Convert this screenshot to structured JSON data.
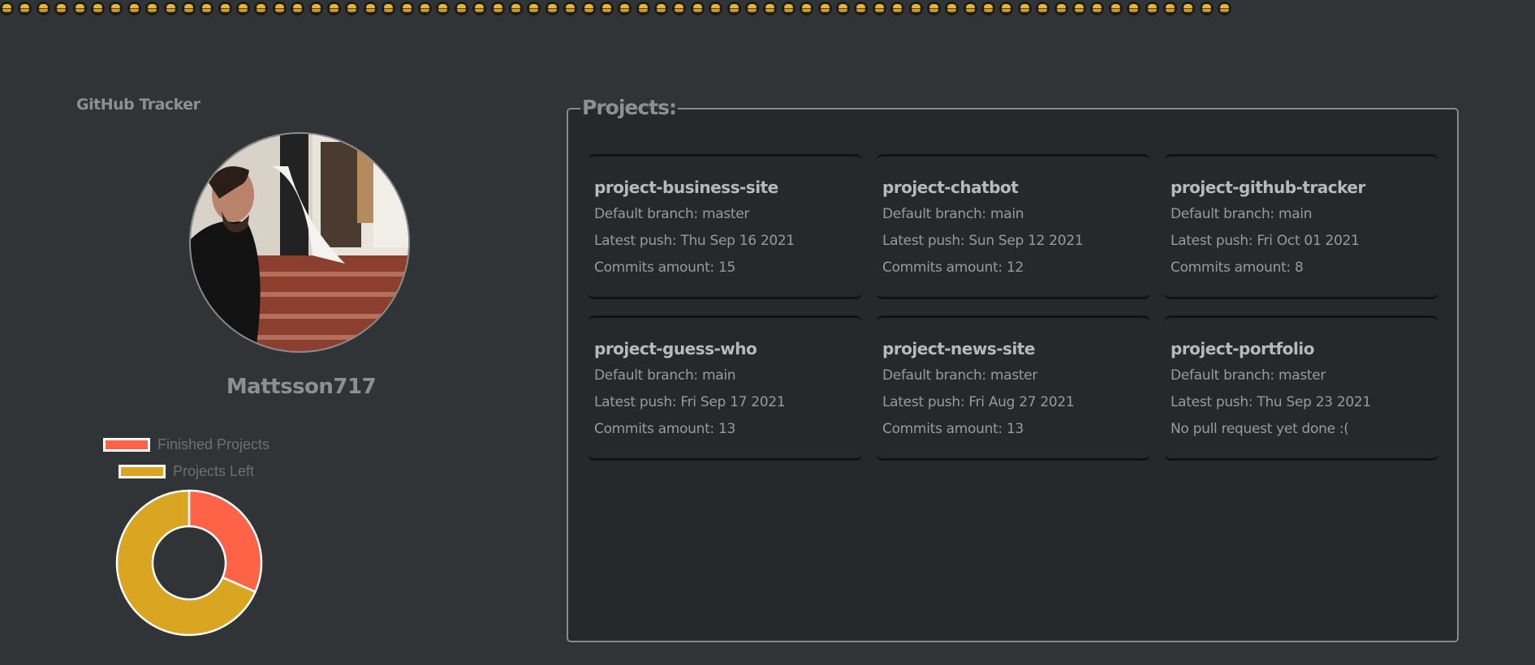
{
  "header": {
    "burger_count": 68
  },
  "sidebar": {
    "title": "GitHub Tracker",
    "avatar_icon": "user-photo",
    "username": "Mattsson717"
  },
  "chart_data": {
    "type": "pie",
    "categories": [
      "Finished Projects",
      "Projects Left"
    ],
    "values": [
      6,
      13
    ],
    "colors": [
      "#ff6347",
      "#daa520"
    ],
    "legend_position": "top"
  },
  "projects": {
    "heading": "Projects:",
    "cards": [
      {
        "name": "project-business-site",
        "branch": "Default branch: master",
        "push": "Latest push: Thu Sep 16 2021",
        "commits": "Commits amount: 15"
      },
      {
        "name": "project-chatbot",
        "branch": "Default branch: main",
        "push": "Latest push: Sun Sep 12 2021",
        "commits": "Commits amount: 12"
      },
      {
        "name": "project-github-tracker",
        "branch": "Default branch: main",
        "push": "Latest push: Fri Oct 01 2021",
        "commits": "Commits amount: 8"
      },
      {
        "name": "project-guess-who",
        "branch": "Default branch: main",
        "push": "Latest push: Fri Sep 17 2021",
        "commits": "Commits amount: 13"
      },
      {
        "name": "project-news-site",
        "branch": "Default branch: master",
        "push": "Latest push: Fri Aug 27 2021",
        "commits": "Commits amount: 13"
      },
      {
        "name": "project-portfolio",
        "branch": "Default branch: master",
        "push": "Latest push: Thu Sep 23 2021",
        "commits": "No pull request yet done :("
      }
    ]
  }
}
